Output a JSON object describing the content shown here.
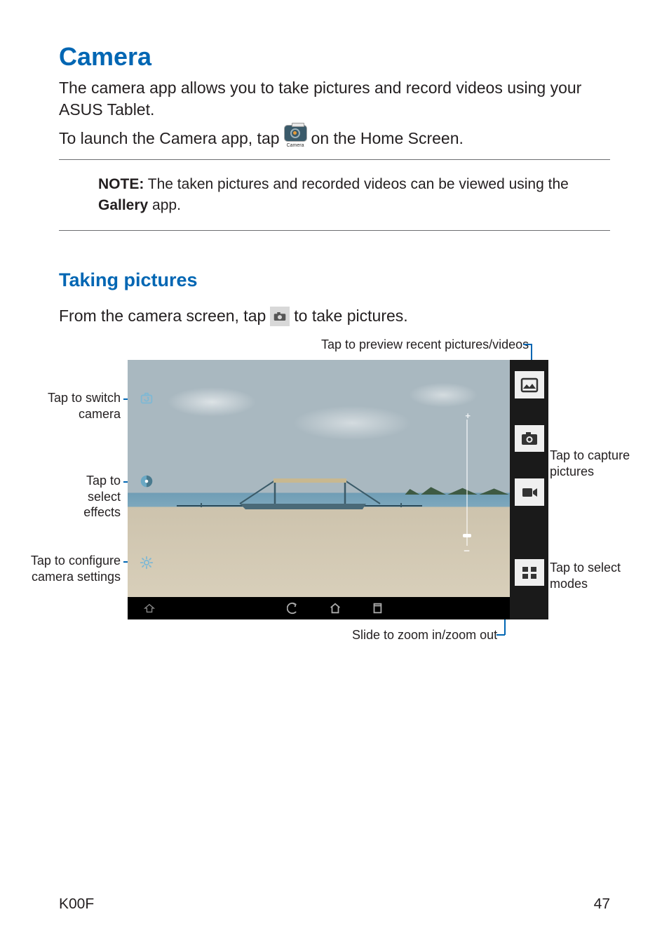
{
  "h1": "Camera",
  "intro": "The camera app allows you to take pictures and record videos using your ASUS Tablet.",
  "launch_pre": "To launch the Camera app, tap",
  "launch_post": " on the Home Screen.",
  "camera_icon_label": "Camera",
  "note": {
    "label": "NOTE:",
    "text": " The taken pictures and recorded videos can be viewed using the ",
    "bold": "Gallery",
    "tail": " app."
  },
  "h2": "Taking pictures",
  "take_pre": "From the camera screen, tap ",
  "take_post": " to take pictures.",
  "callouts": {
    "preview": "Tap to preview recent pictures/videos",
    "switch": "Tap to switch camera",
    "effects": "Tap to select effects",
    "settings": "Tap to configure camera settings",
    "capture": "Tap to capture pictures",
    "modes": "Tap to select modes",
    "zoom": "Slide to zoom in/zoom out"
  },
  "footer": {
    "model": "K00F",
    "page": "47"
  }
}
